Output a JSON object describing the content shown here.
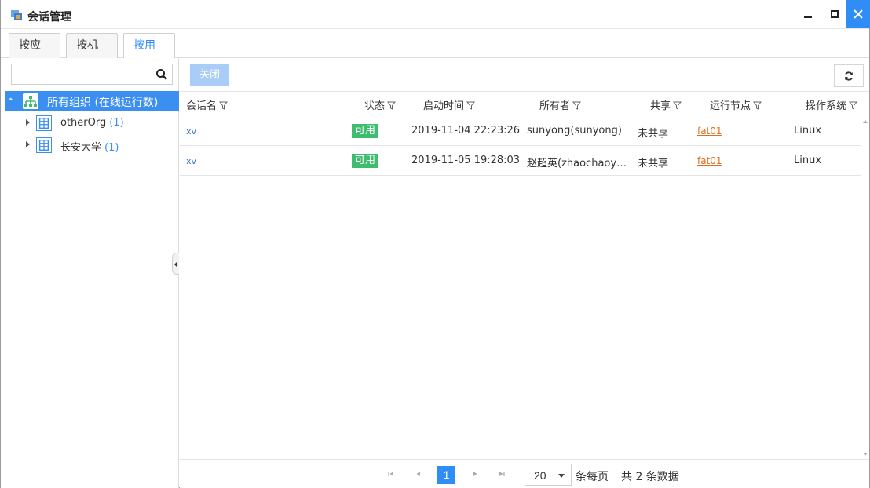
{
  "window": {
    "title": "会话管理",
    "controls": [
      "minimize-icon",
      "maximize-icon",
      "close-icon"
    ],
    "accent_color": "#2f8df5"
  },
  "tabs": [
    {
      "label": "按应用",
      "active": false
    },
    {
      "label": "按机器",
      "active": false
    },
    {
      "label": "按用户",
      "active": true
    }
  ],
  "sidebar": {
    "search": {
      "value": "",
      "placeholder": ""
    },
    "root": {
      "label": "所有组织 (在线运行数)",
      "icon": "org-chart-icon"
    },
    "nodes": [
      {
        "name": "otherOrg",
        "count": "(1)",
        "icon": "department-icon"
      },
      {
        "name": "长安大学",
        "count": "(1)",
        "icon": "department-icon"
      }
    ]
  },
  "toolbar": {
    "close_label": "关闭",
    "refresh_icon": "refresh-icon"
  },
  "table": {
    "columns": [
      "会话名",
      "状态",
      "启动时间",
      "所有者",
      "共享",
      "运行节点",
      "操作系统"
    ],
    "rows": [
      {
        "name": "xv",
        "status": "可用",
        "start_time": "2019-11-04 22:23:26",
        "owner": "sunyong(sunyong)",
        "shared": "未共享",
        "node": "fat01",
        "os": "Linux"
      },
      {
        "name": "xv",
        "status": "可用",
        "start_time": "2019-11-05 19:28:03",
        "owner": "赵超英(zhaochaoy…",
        "shared": "未共享",
        "node": "fat01",
        "os": "Linux"
      }
    ],
    "status_color": "#3ebd6e",
    "node_link_color": "#e06d1a"
  },
  "pager": {
    "current_page": "1",
    "page_size": "20",
    "per_page_label": "条每页",
    "total_label": "共 2 条数据"
  }
}
